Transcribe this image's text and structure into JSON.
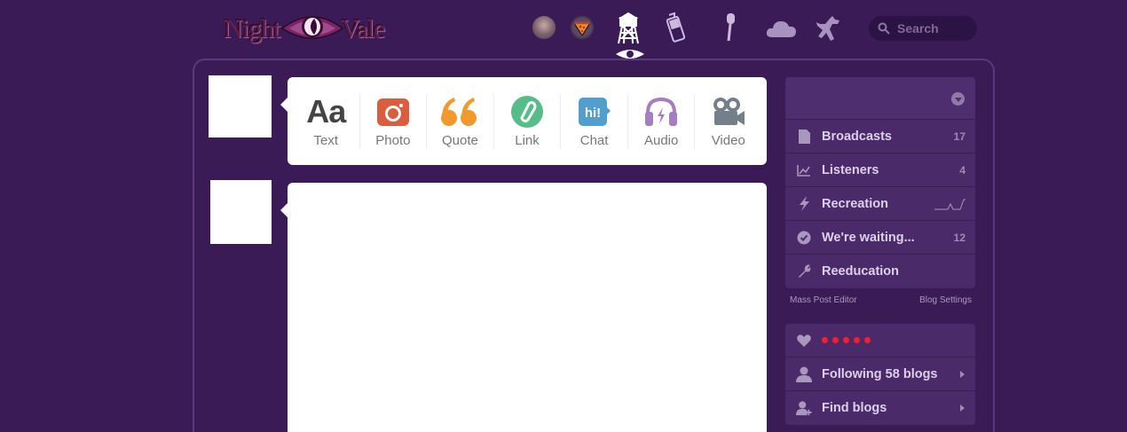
{
  "header": {
    "logo": {
      "left": "Night",
      "right": "Vale"
    },
    "search_placeholder": "Search",
    "nav_icons": [
      "avatar",
      "avatar",
      "water-tower-icon",
      "cell-phone-icon",
      "microphone-icon",
      "cloud-icon",
      "dog-icon"
    ]
  },
  "post_types": [
    {
      "label": "Text",
      "icon": "Aa",
      "color": "#444444"
    },
    {
      "label": "Photo",
      "color": "#d95e40"
    },
    {
      "label": "Quote",
      "color": "#f2992e"
    },
    {
      "label": "Link",
      "color": "#56bc8a"
    },
    {
      "label": "Chat",
      "color": "#529ecc"
    },
    {
      "label": "Audio",
      "color": "#a77dc2"
    },
    {
      "label": "Video",
      "color": "#748089"
    }
  ],
  "sidebar": {
    "items": [
      {
        "label": "Broadcasts",
        "count": "17"
      },
      {
        "label": "Listeners",
        "count": "4"
      },
      {
        "label": "Recreation"
      },
      {
        "label": "We're waiting...",
        "count": "12"
      },
      {
        "label": "Reeducation"
      }
    ],
    "mass_post_editor": "Mass Post Editor",
    "blog_settings": "Blog Settings",
    "secondary": [
      {
        "label": "Following 58 blogs"
      },
      {
        "label": "Find blogs"
      }
    ]
  },
  "colors": {
    "background": "#3a1b56",
    "panel": "#4a2a68",
    "likes_dots": "#ff1a2e"
  }
}
